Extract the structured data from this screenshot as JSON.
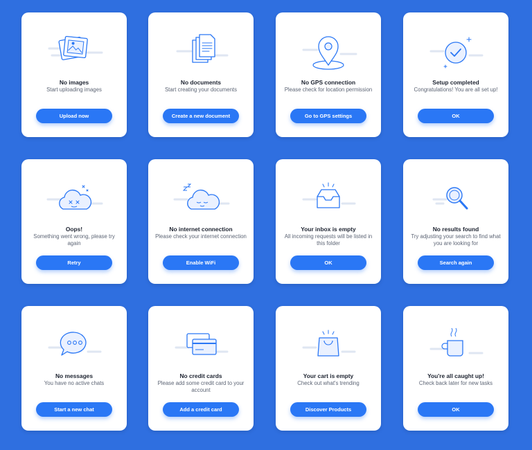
{
  "cards": [
    {
      "title": "No images",
      "desc": "Start uploading images",
      "button": "Upload now",
      "icon": "images-icon"
    },
    {
      "title": "No documents",
      "desc": "Start creating your documents",
      "button": "Create a new document",
      "icon": "documents-icon"
    },
    {
      "title": "No GPS connection",
      "desc": "Please check for location permission",
      "button": "Go to GPS settings",
      "icon": "location-pin-icon"
    },
    {
      "title": "Setup completed",
      "desc": "Congratulations! You are all set up!",
      "button": "OK",
      "icon": "checkmark-circle-icon"
    },
    {
      "title": "Oops!",
      "desc": "Something went wrong, please try again",
      "button": "Retry",
      "icon": "dizzy-cloud-icon"
    },
    {
      "title": "No internet connection",
      "desc": "Please check your internet connection",
      "button": "Enable WiFi",
      "icon": "sleeping-cloud-icon"
    },
    {
      "title": "Your inbox is empty",
      "desc": "All incoming requests will be listed in this folder",
      "button": "OK",
      "icon": "inbox-tray-icon"
    },
    {
      "title": "No results found",
      "desc": "Try adjusting your search to find what you are looking for",
      "button": "Search again",
      "icon": "magnifier-icon"
    },
    {
      "title": "No messages",
      "desc": "You have no active chats",
      "button": "Start a new chat",
      "icon": "chat-bubble-icon"
    },
    {
      "title": "No credit cards",
      "desc": "Please add some credit card to your account",
      "button": "Add a credit card",
      "icon": "credit-cards-icon"
    },
    {
      "title": "Your cart is empty",
      "desc": "Check out what's trending",
      "button": "Discover Products",
      "icon": "shopping-bag-icon"
    },
    {
      "title": "You're all caught up!",
      "desc": "Check back later for new tasks",
      "button": "OK",
      "icon": "coffee-mug-icon"
    }
  ],
  "colors": {
    "background": "#2f6fe0",
    "accent": "#2a77f5",
    "card": "#ffffff"
  }
}
